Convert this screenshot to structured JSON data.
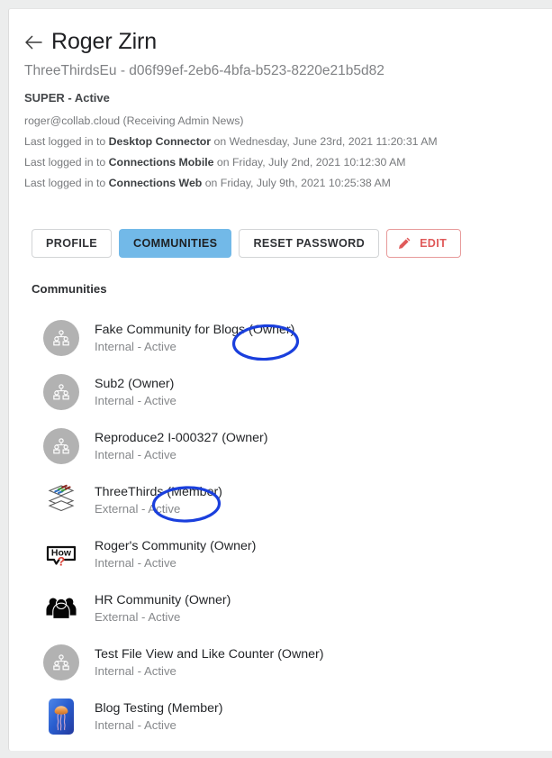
{
  "header": {
    "back_icon": "back-arrow-icon",
    "title": "Roger Zirn",
    "subtitle": "ThreeThirdsEu - d06f99ef-2eb6-4bfa-b523-8220e21b5d82",
    "role_status": "SUPER - Active",
    "email_line": "roger@collab.cloud (Receiving Admin News)",
    "logins": [
      {
        "prefix": "Last logged in to ",
        "app": "Desktop Connector",
        "suffix": " on Wednesday, June 23rd, 2021 11:20:31 AM"
      },
      {
        "prefix": "Last logged in to ",
        "app": "Connections Mobile",
        "suffix": " on Friday, July 2nd, 2021 10:12:30 AM"
      },
      {
        "prefix": "Last logged in to ",
        "app": "Connections Web",
        "suffix": " on Friday, July 9th, 2021 10:25:38 AM"
      }
    ]
  },
  "tabs": {
    "profile": "PROFILE",
    "communities": "COMMUNITIES",
    "reset_password": "RESET PASSWORD",
    "edit": "EDIT",
    "edit_icon": "pencil-icon",
    "active": "COMMUNITIES"
  },
  "section": {
    "title": "Communities"
  },
  "communities": [
    {
      "name": "Fake Community for Blogs (Owner)",
      "status": "Internal - Active",
      "icon": "default-group-avatar-icon"
    },
    {
      "name": "Sub2 (Owner)",
      "status": "Internal - Active",
      "icon": "default-group-avatar-icon"
    },
    {
      "name": "Reproduce2 I-000327 (Owner)",
      "status": "Internal - Active",
      "icon": "default-group-avatar-icon"
    },
    {
      "name": "ThreeThirds (Member)",
      "status": "External - Active",
      "icon": "stacked-layers-icon"
    },
    {
      "name": "Roger's Community (Owner)",
      "status": "Internal - Active",
      "icon": "how-question-bubble-icon"
    },
    {
      "name": "HR Community (Owner)",
      "status": "External - Active",
      "icon": "people-group-icon"
    },
    {
      "name": "Test File View and Like Counter (Owner)",
      "status": "Internal - Active",
      "icon": "default-group-avatar-icon"
    },
    {
      "name": "Blog Testing (Member)",
      "status": "Internal - Active",
      "icon": "jellyfish-icon"
    }
  ],
  "annotations": [
    {
      "label": "owner-circle-annotation",
      "target": "Fake Community for Blogs (Owner)",
      "color": "#1a3fdd"
    },
    {
      "label": "member-circle-annotation",
      "target": "ThreeThirds (Member)",
      "color": "#1a3fdd"
    }
  ],
  "colors": {
    "accent_blue": "#72b9e8",
    "edit_red": "#e05a5a",
    "annotation_blue": "#1a3fdd",
    "avatar_gray": "#b2b2b2"
  }
}
